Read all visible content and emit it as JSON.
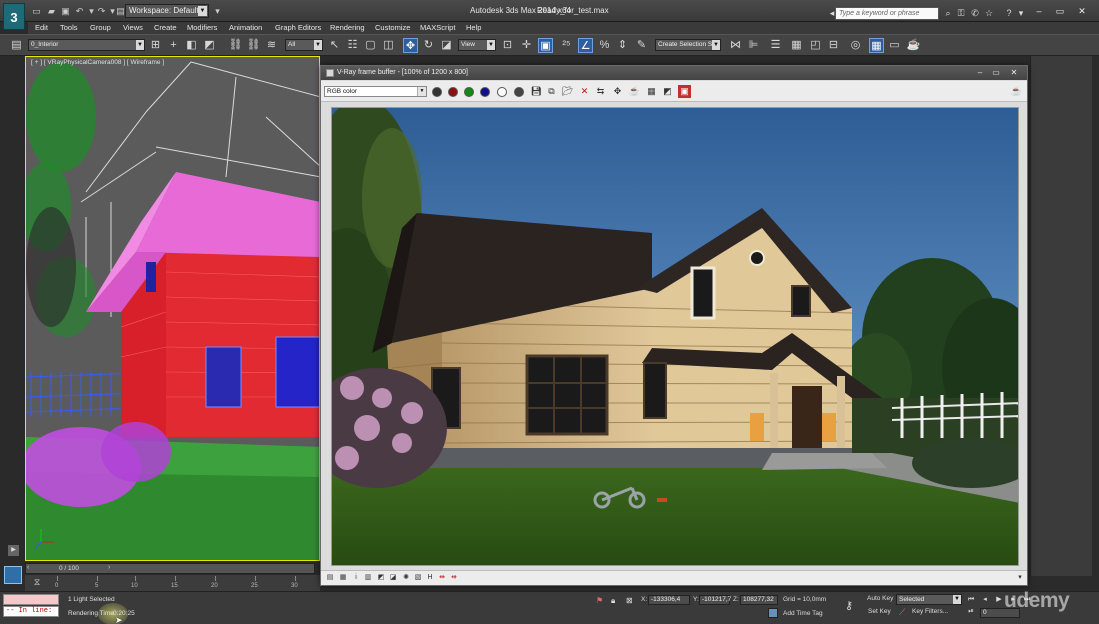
{
  "app": {
    "logo_glyph": "3",
    "title": "Autodesk 3ds Max  2014 x64",
    "file": "Ready_for_test.max",
    "workspace": "Workspace: Default",
    "search_placeholder": "Type a keyword or phrase"
  },
  "menus": [
    "Edit",
    "Tools",
    "Group",
    "Views",
    "Create",
    "Modifiers",
    "Animation",
    "Graph Editors",
    "Rendering",
    "Customize",
    "MAXScript",
    "Help"
  ],
  "toolbar": {
    "layer_dropdown": "0_Interior",
    "filter_dropdown": "All",
    "ref_coord_dropdown": "View",
    "selection_set_dropdown": "Create Selection Se"
  },
  "viewport": {
    "label": "[ + ] [ VRayPhysicalCamera008 ] [ Wireframe ]"
  },
  "timeline": {
    "slider_label": "0 / 100",
    "ticks": [
      "0",
      "5",
      "10",
      "15",
      "20",
      "25",
      "30"
    ]
  },
  "status": {
    "maxscript_line": "-- In line:",
    "selected": "1 Light Selected",
    "render_label": "Rendering Time",
    "render_time": "0:20:25",
    "x_label": "X:",
    "x_value": "-133306,4",
    "y_label": "Y:",
    "y_value": "-101217,7",
    "z_label": "Z:",
    "z_value": "108277,32",
    "grid": "Grid = 10,0mm",
    "add_time_tag": "Add Time Tag",
    "auto_key": "Auto Key",
    "set_key": "Set Key",
    "selected_dropdown": "Selected",
    "key_filters": "Key Filters...",
    "frame": "0",
    "watermark": "udemy"
  },
  "vfb": {
    "title": "V-Ray frame buffer - [100% of 1200 x 800]",
    "channel": "RGB color"
  },
  "colors": {
    "viewport_border": "#e8e800",
    "vfb_bg": "#dcdcdc",
    "ui_dark": "#3a3a3a",
    "accent_blue": "#2e5e9e"
  }
}
